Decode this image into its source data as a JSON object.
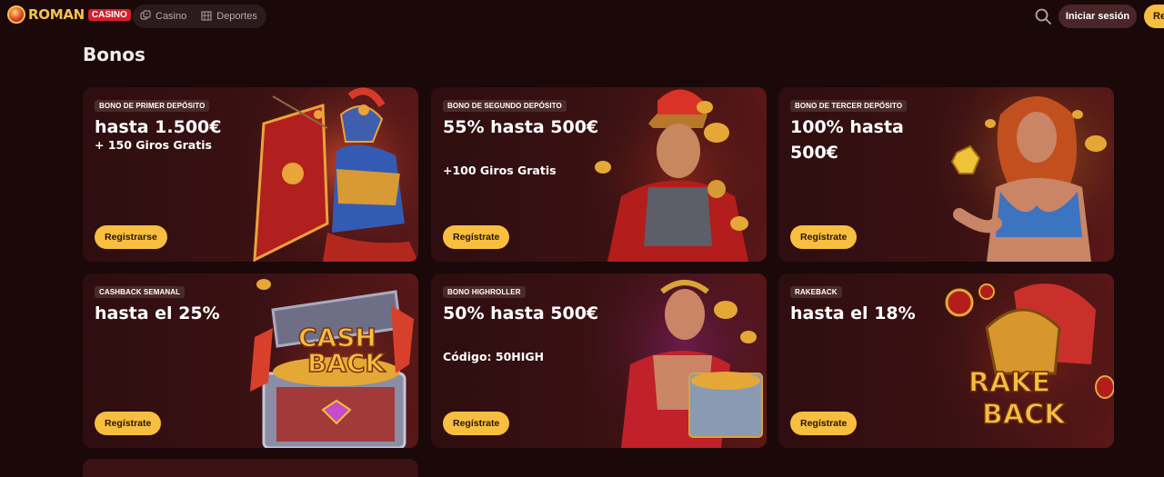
{
  "header": {
    "logo_text": "ROMAN",
    "logo_badge": "CASINO",
    "nav": [
      {
        "label": "Casino",
        "icon": "dice-icon"
      },
      {
        "label": "Deportes",
        "icon": "stadium-icon"
      }
    ],
    "login_label": "Iniciar sesión",
    "register_label": "Re"
  },
  "page": {
    "title": "Bonos"
  },
  "cards": [
    {
      "tag": "BONO DE PRIMER DEPÓSITO",
      "headline": "hasta 1.500€",
      "sub": "+ 150 Giros Gratis",
      "button": "Registrarse",
      "art": "gladiator-shield-art"
    },
    {
      "tag": "BONO DE SEGUNDO DEPÓSITO",
      "headline": "55% hasta 500€",
      "sub": "+100 Giros Gratis",
      "button": "Regístrate",
      "art": "centurion-art"
    },
    {
      "tag": "BONO DE TERCER DEPÓSITO",
      "headline": "100% hasta 500€",
      "sub": "",
      "button": "Regístrate",
      "art": "goddess-art"
    },
    {
      "tag": "CASHBACK SEMANAL",
      "headline": "hasta el 25%",
      "sub": "",
      "button": "Regístrate",
      "art": "cashback-chest-art",
      "art_text": "CASH BACK"
    },
    {
      "tag": "BONO HIGHROLLER",
      "headline": "50% hasta 500€",
      "sub": "Código: 50HIGH",
      "button": "Regístrate",
      "art": "emperor-art"
    },
    {
      "tag": "RAKEBACK",
      "headline": "hasta el 18%",
      "sub": "",
      "button": "Regístrate",
      "art": "rakeback-helmet-art",
      "art_text": "RAKE BACK"
    }
  ],
  "colors": {
    "background": "#1b0809",
    "accent": "#f7be40",
    "card": "#3b1113",
    "tag": "#4a2a2b"
  }
}
